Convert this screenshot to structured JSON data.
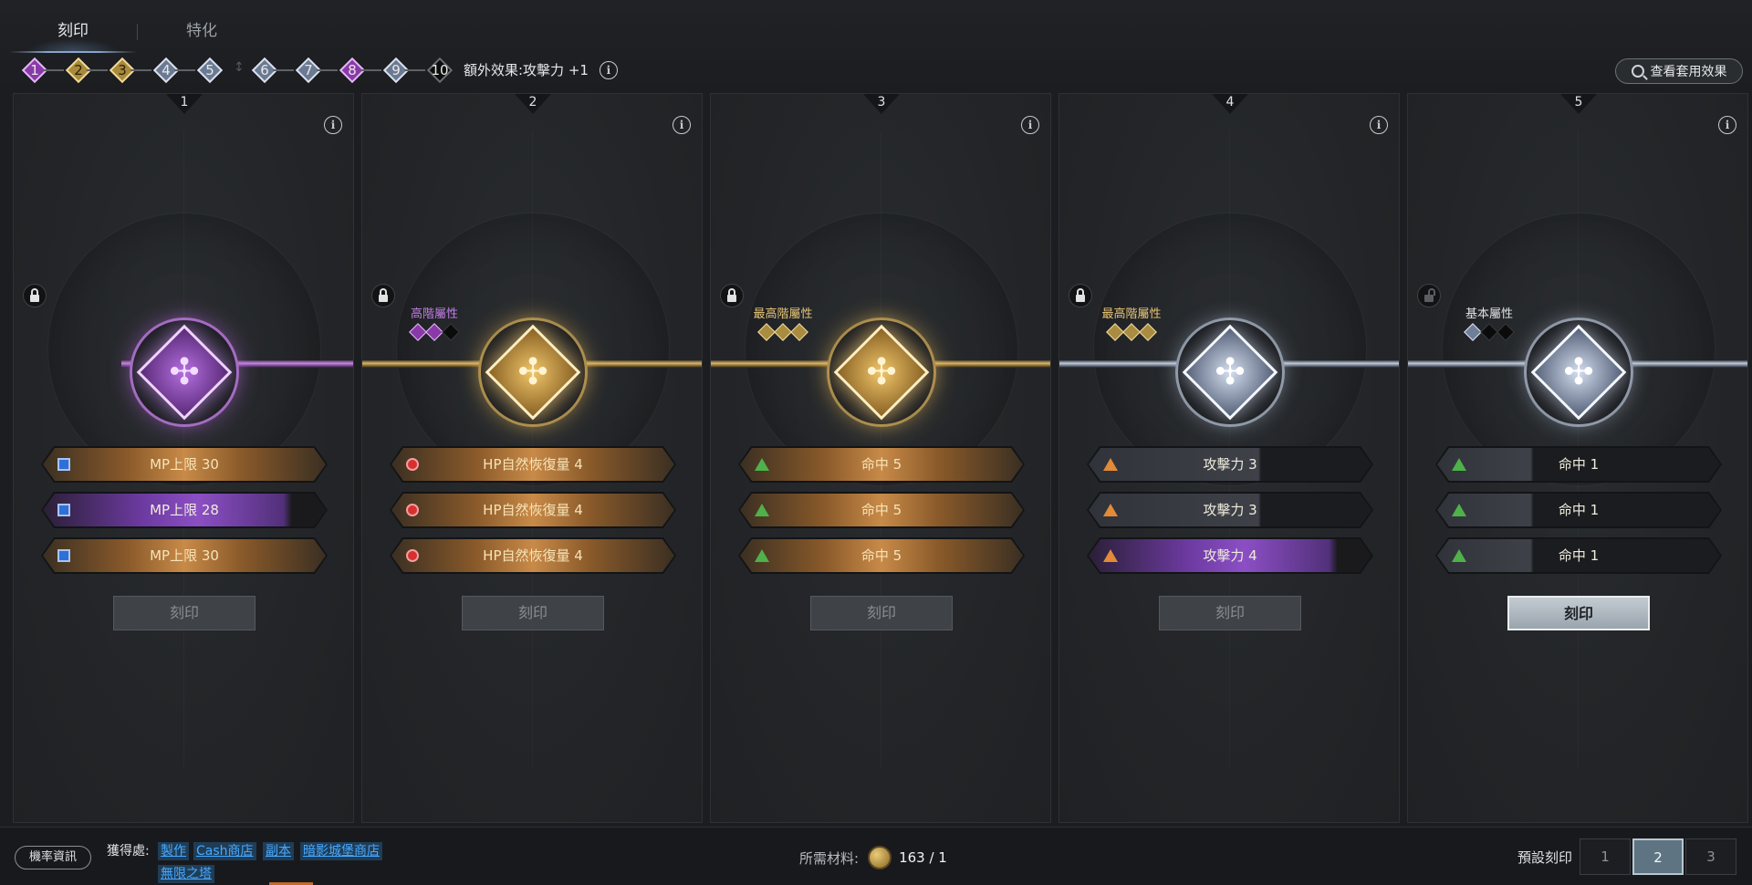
{
  "tabs": [
    {
      "label": "刻印",
      "active": true
    },
    {
      "label": "特化",
      "active": false
    }
  ],
  "steps": [
    {
      "num": "1",
      "color": "purple"
    },
    {
      "num": "2",
      "color": "gold"
    },
    {
      "num": "3",
      "color": "gold"
    },
    {
      "num": "4",
      "color": "silver"
    },
    {
      "num": "5",
      "color": "silver"
    },
    {
      "num": "6",
      "color": "silver"
    },
    {
      "num": "7",
      "color": "silver"
    },
    {
      "num": "8",
      "color": "purple"
    },
    {
      "num": "9",
      "color": "silver"
    },
    {
      "num": "10",
      "color": "black"
    }
  ],
  "bonus": {
    "label": "額外效果:攻擊力 +1"
  },
  "view_button": {
    "label": "查看套用效果"
  },
  "panels": [
    {
      "num": "1",
      "locked": true,
      "tier_name": "",
      "tier_gems": [],
      "emblem_color": "purple",
      "stats": [
        {
          "text": "MP上限 30",
          "icon": "square",
          "style": "orange"
        },
        {
          "text": "MP上限 28",
          "icon": "square",
          "style": "violet"
        },
        {
          "text": "MP上限 30",
          "icon": "square",
          "style": "orange"
        }
      ],
      "button": "刻印",
      "button_enabled": false
    },
    {
      "num": "2",
      "locked": true,
      "tier_name": "高階屬性",
      "tier_color": "#c47ee8",
      "tier_gems": [
        "purple",
        "purple",
        "black"
      ],
      "emblem_color": "gold",
      "stats": [
        {
          "text": "HP自然恢復量 4",
          "icon": "circle",
          "style": "orange"
        },
        {
          "text": "HP自然恢復量 4",
          "icon": "circle",
          "style": "orange"
        },
        {
          "text": "HP自然恢復量 4",
          "icon": "circle",
          "style": "orange"
        }
      ],
      "button": "刻印",
      "button_enabled": false
    },
    {
      "num": "3",
      "locked": true,
      "tier_name": "最高階屬性",
      "tier_color": "#e8c676",
      "tier_gems": [
        "gold",
        "gold",
        "gold"
      ],
      "emblem_color": "gold",
      "stats": [
        {
          "text": "命中 5",
          "icon": "tri-green",
          "style": "orange"
        },
        {
          "text": "命中 5",
          "icon": "tri-green",
          "style": "orange"
        },
        {
          "text": "命中 5",
          "icon": "tri-green",
          "style": "orange"
        }
      ],
      "button": "刻印",
      "button_enabled": false
    },
    {
      "num": "4",
      "locked": true,
      "tier_name": "最高階屬性",
      "tier_color": "#e8c676",
      "tier_gems": [
        "gold",
        "gold",
        "gold"
      ],
      "emblem_color": "silver",
      "stats": [
        {
          "text": "攻擊力 3",
          "icon": "tri-orange",
          "style": "dark"
        },
        {
          "text": "攻擊力 3",
          "icon": "tri-orange",
          "style": "dark"
        },
        {
          "text": "攻擊力 4",
          "icon": "tri-orange",
          "style": "violet"
        }
      ],
      "button": "刻印",
      "button_enabled": false
    },
    {
      "num": "5",
      "locked": false,
      "tier_name": "基本屬性",
      "tier_color": "#e0e2e4",
      "tier_gems": [
        "silver",
        "black",
        "black"
      ],
      "emblem_color": "silver",
      "stats": [
        {
          "text": "命中 1",
          "icon": "tri-green",
          "style": "dark2"
        },
        {
          "text": "命中 1",
          "icon": "tri-green",
          "style": "dark2"
        },
        {
          "text": "命中 1",
          "icon": "tri-green",
          "style": "dark2"
        }
      ],
      "button": "刻印",
      "button_enabled": true
    }
  ],
  "bottom": {
    "probability_button": "機率資訊",
    "source_label": "獲得處:",
    "source_links": [
      "製作",
      "Cash商店",
      "副本",
      "暗影城堡商店",
      "無限之塔"
    ],
    "materials_label": "所需材料:",
    "materials_value": "163 / 1",
    "preset_label": "預設刻印",
    "presets": [
      "1",
      "2",
      "3"
    ],
    "active_preset": "2"
  },
  "colors": {
    "purple": "#8a3aa8",
    "gold": "#a88a3a",
    "silver": "#6b7a93",
    "link": "#47a9ff"
  },
  "icons": {
    "info": "info-icon",
    "lock": "lock-icon",
    "search": "search-icon",
    "coin": "coin-icon"
  }
}
